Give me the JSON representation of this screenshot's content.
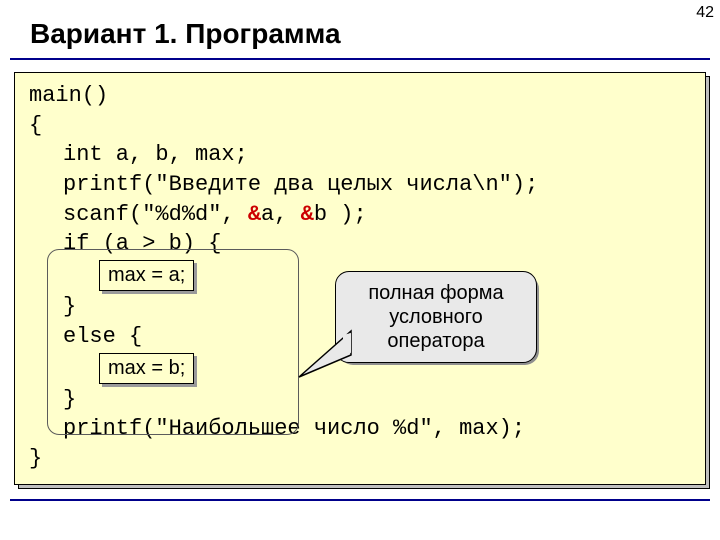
{
  "page_number": "42",
  "title": "Вариант 1. Программа",
  "code": {
    "l1": "main()",
    "l2": "{",
    "l3": "int a, b, max;",
    "l4a": "printf(\"Введите два целых числа\\n\");",
    "l5a": "scanf(\"%d%d\", ",
    "amp_a": "&",
    "l5b": "a, ",
    "amp_b": "&",
    "l5c": "b );",
    "l6": "if (a > b) {",
    "max_a": "max = a;",
    "l7": "}",
    "l8": "else {",
    "max_b": "max = b;",
    "l9": "}",
    "l10": "printf(\"Наибольшее число %d\", max);",
    "l11": "}"
  },
  "callout": {
    "line1": "полная форма",
    "line2": "условного",
    "line3": "оператора"
  }
}
